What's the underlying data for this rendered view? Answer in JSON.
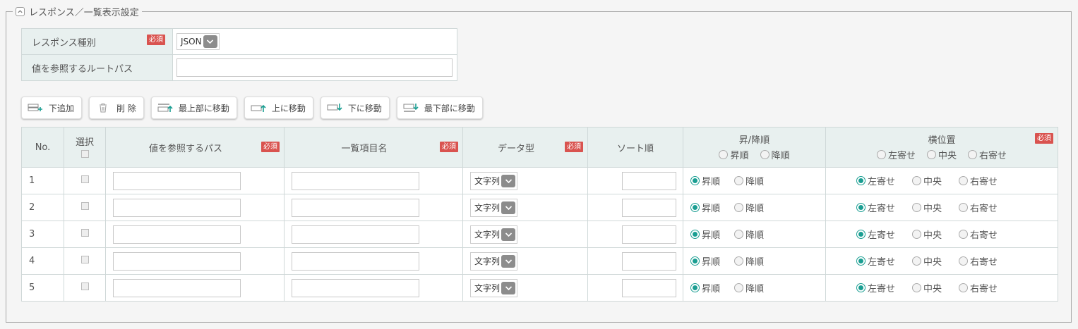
{
  "section": {
    "title": "レスポンス／一覧表示設定"
  },
  "required_label": "必須",
  "response_type": {
    "label": "レスポンス種別",
    "value": "JSON"
  },
  "root_path": {
    "label": "値を参照するルートパス",
    "value": ""
  },
  "toolbar": {
    "add_below": "下追加",
    "delete": "削 除",
    "move_top": "最上部に移動",
    "move_up": "上に移動",
    "move_down": "下に移動",
    "move_bottom": "最下部に移動"
  },
  "columns": {
    "no": "No.",
    "select": "選択",
    "path": "値を参照するパス",
    "item_name": "一覧項目名",
    "data_type": "データ型",
    "sort_order": "ソート順",
    "asc_desc": "昇/降順",
    "asc": "昇順",
    "desc": "降順",
    "align": "横位置",
    "left": "左寄せ",
    "center": "中央",
    "right": "右寄せ"
  },
  "rows": [
    {
      "no": "1",
      "path": "",
      "item_name": "",
      "data_type": "文字列",
      "sort": "",
      "order": "asc",
      "align": "left"
    },
    {
      "no": "2",
      "path": "",
      "item_name": "",
      "data_type": "文字列",
      "sort": "",
      "order": "asc",
      "align": "left"
    },
    {
      "no": "3",
      "path": "",
      "item_name": "",
      "data_type": "文字列",
      "sort": "",
      "order": "asc",
      "align": "left"
    },
    {
      "no": "4",
      "path": "",
      "item_name": "",
      "data_type": "文字列",
      "sort": "",
      "order": "asc",
      "align": "left"
    },
    {
      "no": "5",
      "path": "",
      "item_name": "",
      "data_type": "文字列",
      "sort": "",
      "order": "asc",
      "align": "left"
    }
  ],
  "colors": {
    "accent": "#1a9e92",
    "required": "#d9534f",
    "label_bg": "#e8f0ef"
  }
}
